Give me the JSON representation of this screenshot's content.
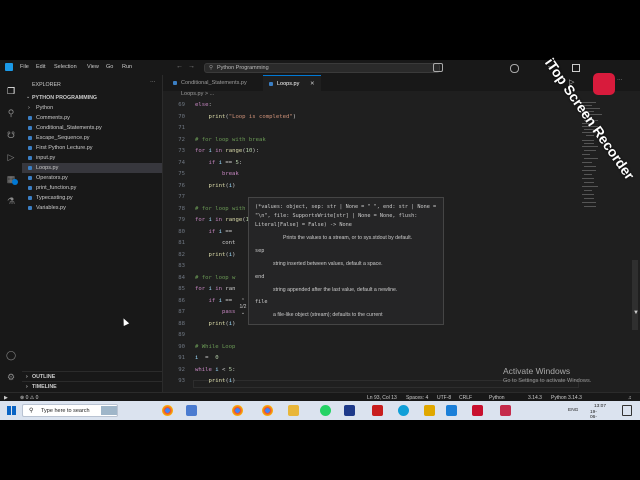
{
  "titlebar": {
    "menu": [
      "File",
      "Edit",
      "Selection",
      "View",
      "Go",
      "Run"
    ],
    "command_center": "Python Programming"
  },
  "explorer": {
    "header": "EXPLORER",
    "folder": "PYTHON PROGRAMMING",
    "files": [
      "Python",
      "Comments.py",
      "Conditional_Statements.py",
      "Escape_Sequence.py",
      "First Python Lecture.py",
      "input.py",
      "Loops.py",
      "Operators.py",
      "print_function.py",
      "Typecasting.py",
      "Variables.py"
    ],
    "selected": "Loops.py",
    "outline": "OUTLINE",
    "timeline": "TIMELINE"
  },
  "tabs": [
    {
      "label": "Conditional_Statements.py",
      "active": false
    },
    {
      "label": "Loops.py",
      "active": true
    }
  ],
  "breadcrumb": "Loops.py > ...",
  "editor": {
    "lines": [
      {
        "n": "69",
        "t": "else:"
      },
      {
        "n": "70",
        "t": "    print(\"Loop is completed\")"
      },
      {
        "n": "71",
        "t": ""
      },
      {
        "n": "72",
        "t": "# for loop with break"
      },
      {
        "n": "73",
        "t": "for i in range(10):"
      },
      {
        "n": "74",
        "t": "    if i == 5:"
      },
      {
        "n": "75",
        "t": "        break"
      },
      {
        "n": "76",
        "t": "    print(i)"
      },
      {
        "n": "77",
        "t": ""
      },
      {
        "n": "78",
        "t": "# for loop with continue"
      },
      {
        "n": "79",
        "t": "for i in range(10):"
      },
      {
        "n": "80",
        "t": "    if i =="
      },
      {
        "n": "81",
        "t": "        cont"
      },
      {
        "n": "82",
        "t": "    print(i)"
      },
      {
        "n": "83",
        "t": ""
      },
      {
        "n": "84",
        "t": "# for loop w"
      },
      {
        "n": "85",
        "t": "for i in ran"
      },
      {
        "n": "86",
        "t": "    if i =="
      },
      {
        "n": "87",
        "t": "        pass"
      },
      {
        "n": "88",
        "t": "    print(i)"
      },
      {
        "n": "89",
        "t": ""
      },
      {
        "n": "90",
        "t": "# While Loop"
      },
      {
        "n": "91",
        "t": "i  =  0"
      },
      {
        "n": "92",
        "t": "while i < 5:"
      },
      {
        "n": "93",
        "t": "    print(i)"
      }
    ]
  },
  "hover": {
    "signature": "(*values: object, sep: str | None = \" \", end: str | None = \"\\n\", file: SupportsWrite[str] | None = None, flush: Literal[False] = False) -> None",
    "description": "Prints the values to a stream, or to sys.stdout by default.",
    "params": [
      {
        "name": "sep",
        "desc": "string inserted between values, default a space."
      },
      {
        "name": "end",
        "desc": "string appended after the last value, default a newline."
      },
      {
        "name": "file",
        "desc": "a file-like object (stream); defaults to the current"
      }
    ],
    "pager": "1/2"
  },
  "activate": {
    "title": "Activate Windows",
    "subtitle": "Go to Settings to activate Windows."
  },
  "status": {
    "position": "Ln 93, Col 13",
    "spaces": "Spaces: 4",
    "encoding": "UTF-8",
    "eol": "CRLF",
    "language": "Python",
    "version1": "3.14.3",
    "version2": "Python 3.14.3"
  },
  "taskbar": {
    "search": "Type here to search",
    "lang": "ENG",
    "time": "13:07",
    "date": "19-06-2026"
  },
  "watermark": "iTop Screen Recorder",
  "colors": {
    "accent": "#0078d4",
    "badge": "#0078d4",
    "taskbar": "#dbe3ef"
  }
}
